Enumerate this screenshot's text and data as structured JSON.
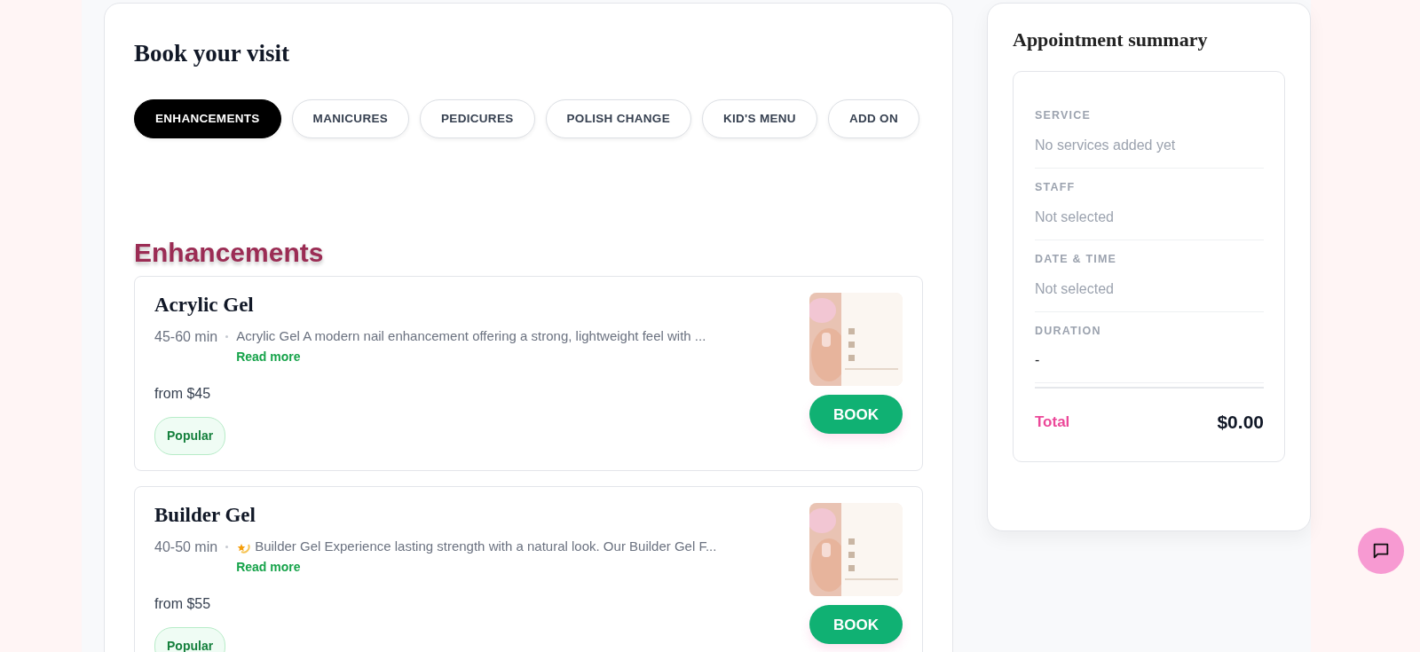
{
  "booking": {
    "title": "Book your visit",
    "tabs": [
      {
        "label": "ENHANCEMENTS",
        "selected": true
      },
      {
        "label": "MANICURES",
        "selected": false
      },
      {
        "label": "PEDICURES",
        "selected": false
      },
      {
        "label": "POLISH CHANGE",
        "selected": false
      },
      {
        "label": "KID'S MENU",
        "selected": false
      },
      {
        "label": "ADD ON",
        "selected": false
      }
    ],
    "section_title": "Enhancements",
    "services": [
      {
        "name": "Acrylic Gel",
        "duration": "45-60 min",
        "lead_icon": false,
        "description": "Acrylic Gel A modern nail enhancement offering a strong, lightweight feel with ...",
        "read_more": "Read more",
        "price": "from $45",
        "tag": "Popular",
        "button": "BOOK"
      },
      {
        "name": "Builder Gel",
        "duration": "40-50 min",
        "lead_icon": true,
        "description": "Builder Gel Experience lasting strength with a natural look. Our Builder Gel F...",
        "read_more": "Read more",
        "price": "from $55",
        "tag": "Popular",
        "button": "BOOK"
      }
    ]
  },
  "summary": {
    "title": "Appointment summary",
    "rows": [
      {
        "label": "SERVICE",
        "value": "No services added yet",
        "muted": true
      },
      {
        "label": "STAFF",
        "value": "Not selected",
        "muted": true
      },
      {
        "label": "DATE & TIME",
        "value": "Not selected",
        "muted": true
      },
      {
        "label": "DURATION",
        "value": "-",
        "muted": false
      }
    ],
    "total_label": "Total",
    "total_value": "$0.00"
  }
}
